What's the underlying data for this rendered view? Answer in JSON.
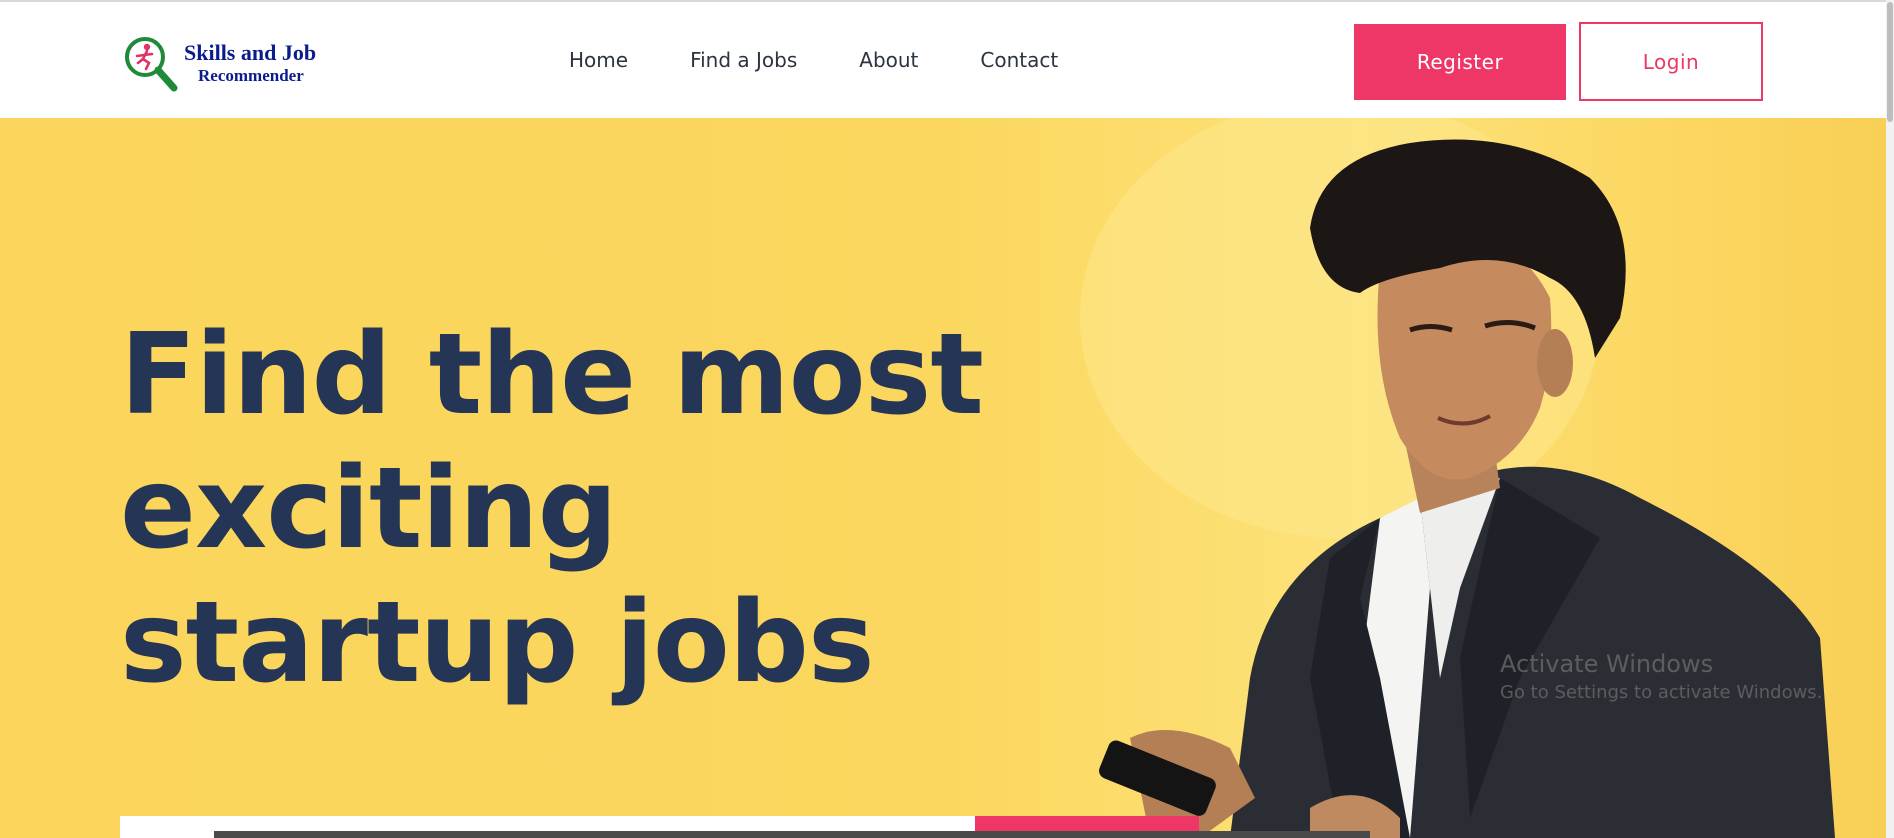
{
  "header": {
    "logo": {
      "line1": "Skills and Job",
      "line2": "Recommender"
    },
    "nav": [
      "Home",
      "Find a Jobs",
      "About",
      "Contact"
    ],
    "register_label": "Register",
    "login_label": "Login"
  },
  "hero": {
    "title_lines": [
      "Find the most",
      "exciting",
      "startup jobs"
    ]
  },
  "watermark": {
    "title": "Activate Windows",
    "subtitle": "Go to Settings to activate Windows."
  },
  "colors": {
    "accent": "#ee3767",
    "heading": "#253556",
    "hero_background": "#fbd55b",
    "logo_text": "#0c1c8c"
  },
  "icons": [
    "logo-magnifier-icon"
  ]
}
